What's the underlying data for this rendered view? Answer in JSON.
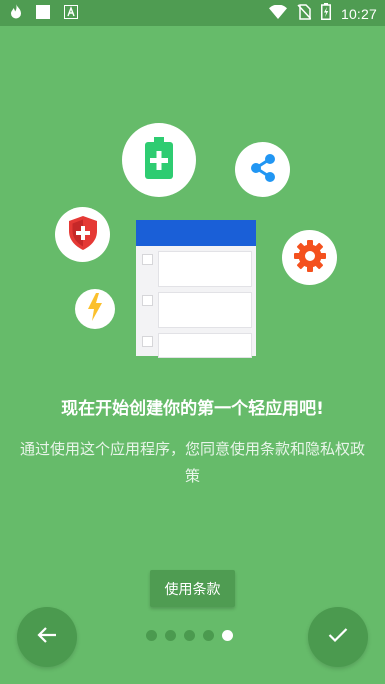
{
  "status_bar": {
    "time": "10:27",
    "icons": [
      "fire-icon",
      "square-notification-icon",
      "letter-a-icon",
      "wifi-icon",
      "no-sim-icon",
      "battery-charging-icon"
    ]
  },
  "illustration": {
    "icons": [
      "battery-plus-icon",
      "share-icon",
      "shield-icon",
      "gear-icon",
      "lightning-icon",
      "list-document-icon"
    ],
    "colors": {
      "background": "#66bb6a",
      "battery": "#2ecc71",
      "share": "#2196f3",
      "shield": "#e53935",
      "gear": "#f4511e",
      "lightning": "#fbc02d",
      "list_header": "#1a5fd7"
    }
  },
  "onboarding": {
    "title": "现在开始创建你的第一个轻应用吧!",
    "description": "通过使用这个应用程序，您同意使用条款和隐私权政策",
    "terms_button": "使用条款"
  },
  "pager": {
    "total": 5,
    "current": 5
  },
  "navigation": {
    "back_icon": "arrow-left-icon",
    "done_icon": "check-icon"
  }
}
